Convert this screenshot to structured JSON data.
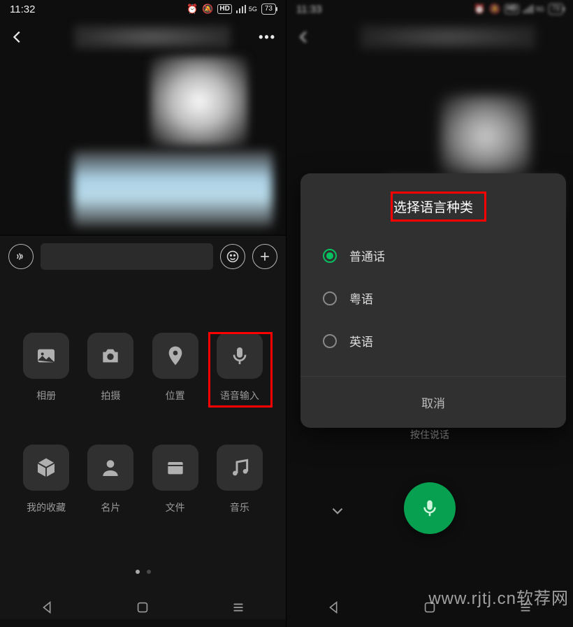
{
  "left": {
    "status_time": "11:32",
    "battery": "73",
    "attachments": [
      {
        "key": "album",
        "label": "相册"
      },
      {
        "key": "camera",
        "label": "拍摄"
      },
      {
        "key": "location",
        "label": "位置"
      },
      {
        "key": "voice",
        "label": "语音输入"
      },
      {
        "key": "fav",
        "label": "我的收藏"
      },
      {
        "key": "contact",
        "label": "名片"
      },
      {
        "key": "file",
        "label": "文件"
      },
      {
        "key": "music",
        "label": "音乐"
      }
    ]
  },
  "right": {
    "status_time": "11:33",
    "battery": "73",
    "dialog_title": "选择语言种类",
    "languages": [
      {
        "label": "普通话",
        "selected": true
      },
      {
        "label": "粤语",
        "selected": false
      },
      {
        "label": "英语",
        "selected": false
      }
    ],
    "cancel": "取消",
    "hold_hint": "按住说话"
  },
  "watermark": "www.rjtj.cn软荐网"
}
